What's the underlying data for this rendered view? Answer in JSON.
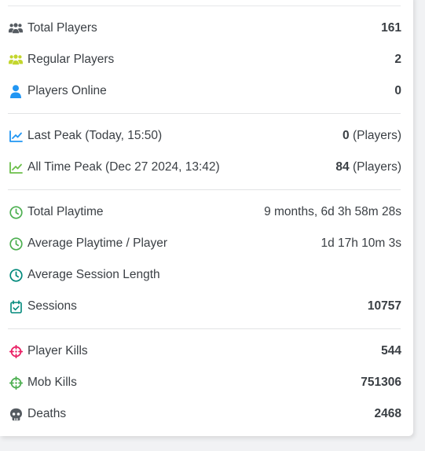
{
  "players": {
    "total": {
      "label": "Total Players",
      "value": "161"
    },
    "regular": {
      "label": "Regular Players",
      "value": "2"
    },
    "online": {
      "label": "Players Online",
      "value": "0"
    }
  },
  "peaks": {
    "last": {
      "label": "Last Peak (Today, 15:50)",
      "value": "0",
      "unit": "(Players)"
    },
    "all_time": {
      "label": "All Time Peak (Dec 27 2024, 13:42)",
      "value": "84",
      "unit": "(Players)"
    }
  },
  "playtime": {
    "total": {
      "label": "Total Playtime",
      "value": "9 months, 6d 3h 58m 28s"
    },
    "average": {
      "label": "Average Playtime / Player",
      "value": "1d 17h 10m 3s"
    },
    "session_length": {
      "label": "Average Session Length",
      "value": ""
    },
    "sessions": {
      "label": "Sessions",
      "value": "10757"
    }
  },
  "kills": {
    "player": {
      "label": "Player Kills",
      "value": "544"
    },
    "mob": {
      "label": "Mob Kills",
      "value": "751306"
    },
    "deaths": {
      "label": "Deaths",
      "value": "2468"
    }
  },
  "colors": {
    "users_icon": "#555b61",
    "regular_icon": "#c3d62d",
    "online_icon": "#2196f3",
    "last_peak_icon": "#2196f3",
    "all_peak_icon": "#6cbf4a",
    "clock_green": "#4caf50",
    "clock_teal": "#00897b",
    "calendar_teal": "#00897b",
    "crosshair_red": "#e91e63",
    "crosshair_green": "#4caf50",
    "skull": "#555b61"
  }
}
